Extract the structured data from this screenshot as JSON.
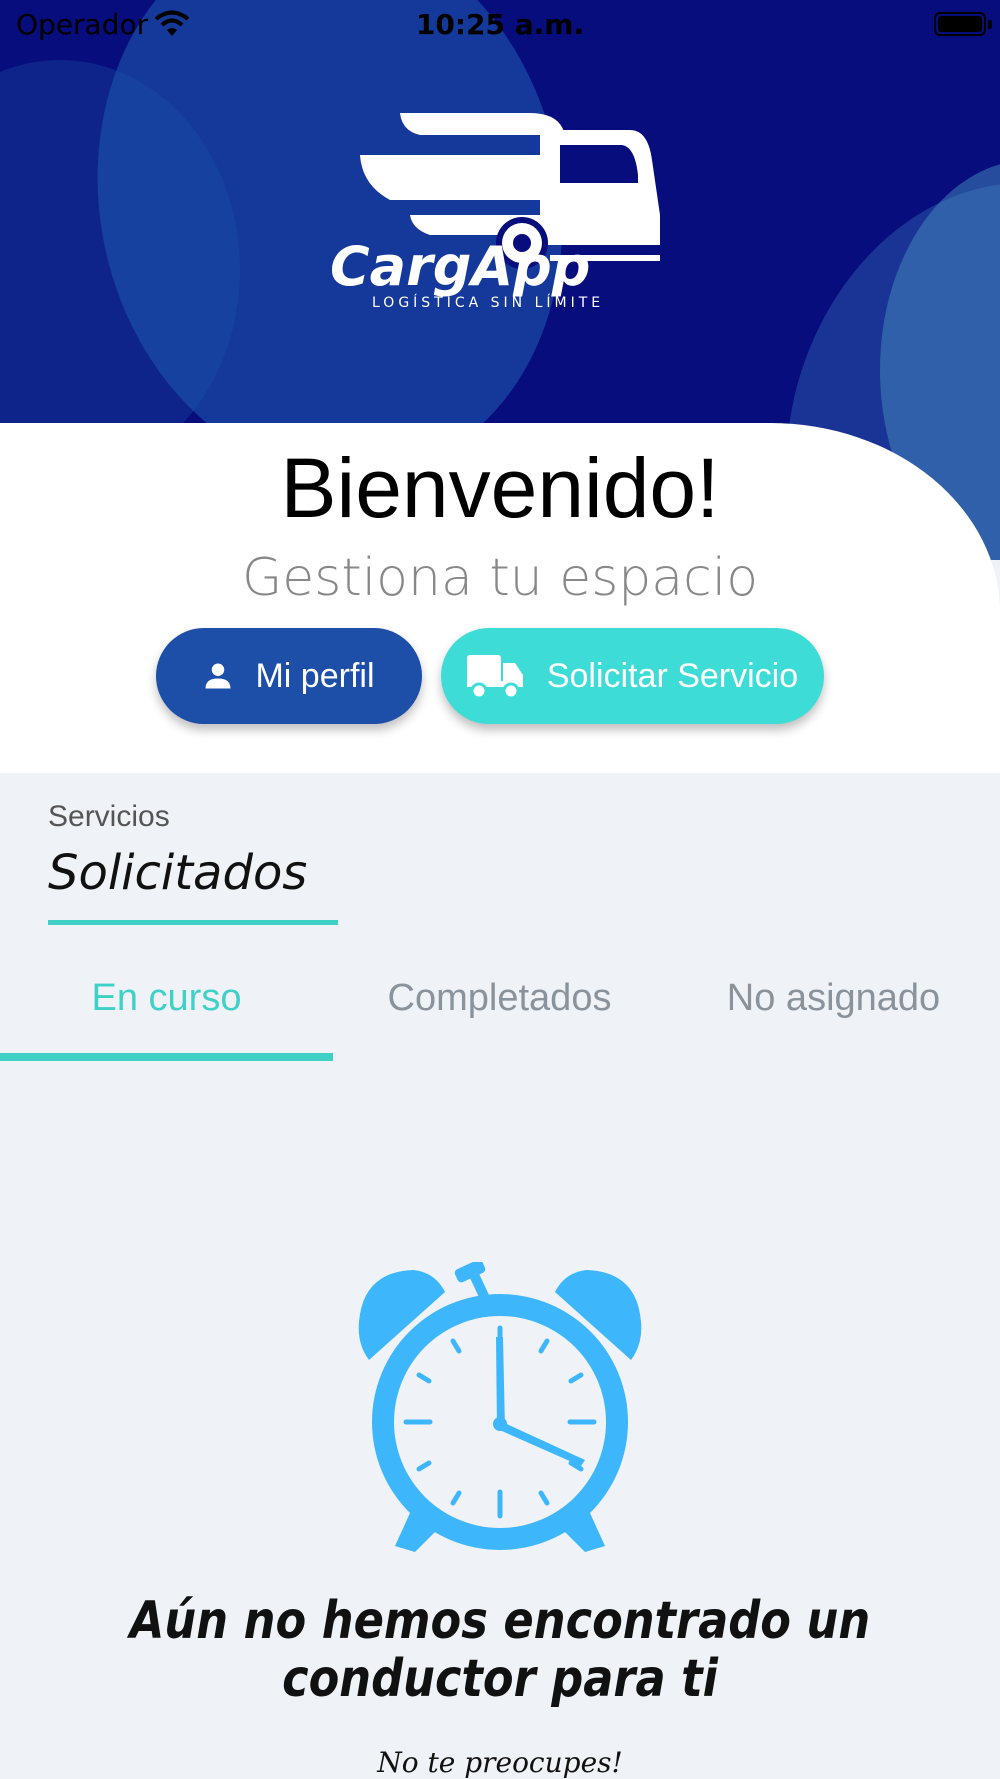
{
  "status_bar": {
    "carrier": "Operador",
    "time": "10:25 a.m."
  },
  "logo": {
    "brand": "CargApp",
    "tagline": "LOGÍSTICA SIN LÍMITE"
  },
  "welcome": {
    "title": "Bienvenido!",
    "subtitle": "Gestiona tu espacio"
  },
  "actions": {
    "profile_label": "Mi perfil",
    "request_label": "Solicitar Servicio"
  },
  "services": {
    "label": "Servicios",
    "title": "Solicitados"
  },
  "tabs": [
    {
      "label": "En curso",
      "active": true
    },
    {
      "label": "Completados",
      "active": false
    },
    {
      "label": "No asignado",
      "active": false
    }
  ],
  "empty_state": {
    "icon": "alarm-clock-icon",
    "message_line1": "Aún no hemos encontrado un",
    "message_line2": "conductor para ti",
    "sub": "No te preocupes!"
  },
  "colors": {
    "hero": "#070d7c",
    "primary_button": "#1d4ea8",
    "accent": "#3edcd6",
    "clock": "#3db6fb"
  }
}
